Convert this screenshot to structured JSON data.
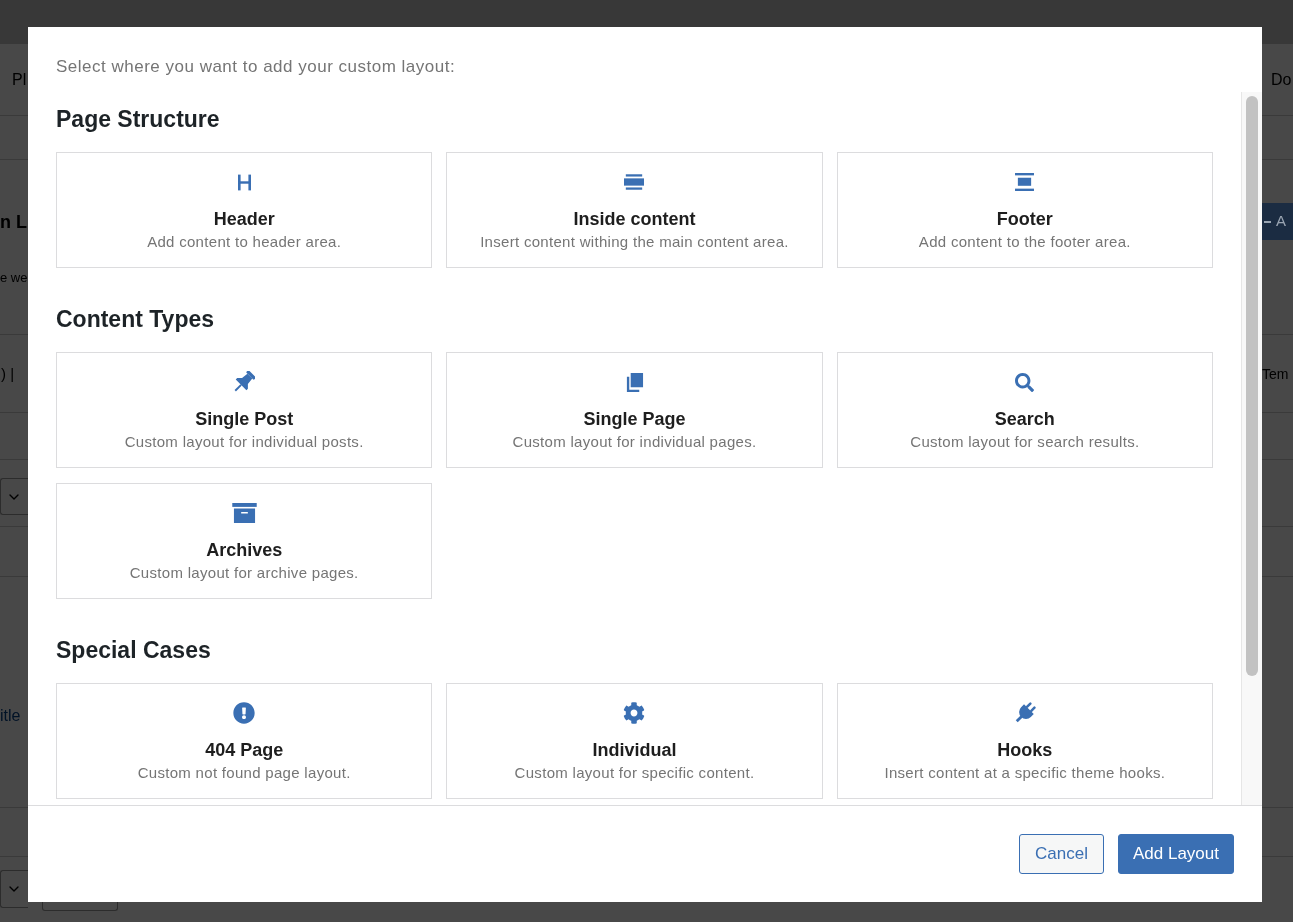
{
  "background_page": {
    "left_menu": "Pl",
    "right_menu": "Do",
    "page_title": "n L",
    "page_description": "e we",
    "add_button": "A",
    "filter_links": ") |",
    "column_label": "Tem",
    "table_link": "itle"
  },
  "dialog": {
    "intro": "Select where you want to add your custom layout:",
    "sections": [
      {
        "title": "Page Structure",
        "options": [
          {
            "kind": "header",
            "title": "Header",
            "description": "Add content to header area.",
            "selected": false
          },
          {
            "kind": "inside",
            "title": "Inside content",
            "description": "Insert content withing the main content area.",
            "selected": false
          },
          {
            "kind": "footer",
            "title": "Footer",
            "description": "Add content to the footer area.",
            "selected": false
          }
        ]
      },
      {
        "title": "Content Types",
        "options": [
          {
            "kind": "post",
            "title": "Single Post",
            "description": "Custom layout for individual posts.",
            "selected": false
          },
          {
            "kind": "page",
            "title": "Single Page",
            "description": "Custom layout for individual pages.",
            "selected": false
          },
          {
            "kind": "search",
            "title": "Search",
            "description": "Custom layout for search results.",
            "selected": false
          },
          {
            "kind": "archive",
            "title": "Archives",
            "description": "Custom layout for archive pages.",
            "selected": false
          }
        ]
      },
      {
        "title": "Special Cases",
        "options": [
          {
            "kind": "not_found",
            "title": "404 Page",
            "description": "Custom not found page layout.",
            "selected": false
          },
          {
            "kind": "individual",
            "title": "Individual",
            "description": "Custom layout for specific content.",
            "selected": false
          },
          {
            "kind": "hooks",
            "title": "Hooks",
            "description": "Insert content at a specific theme hooks.",
            "selected": false
          }
        ]
      }
    ],
    "buttons": [
      {
        "kind": "secondary",
        "label": "Cancel"
      },
      {
        "kind": "primary",
        "label": "Add Layout"
      }
    ]
  }
}
